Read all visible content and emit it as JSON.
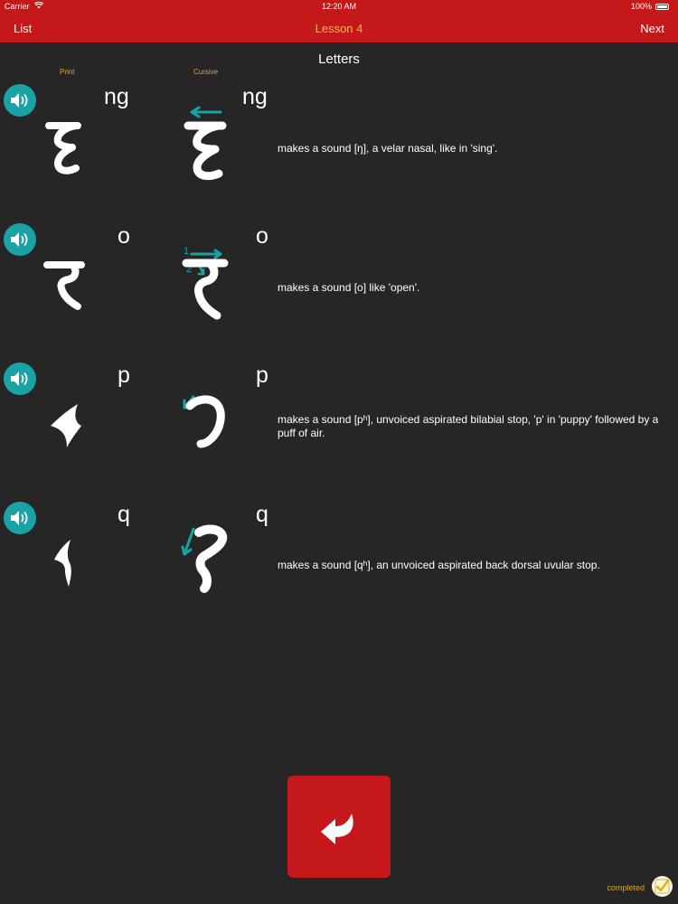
{
  "status_bar": {
    "carrier": "Carrier",
    "time": "12:20 AM",
    "battery": "100%"
  },
  "nav": {
    "left": "List",
    "title": "Lesson 4",
    "right": "Next"
  },
  "section": {
    "title": "Letters",
    "print_label": "Print",
    "cursive_label": "Cursive"
  },
  "letters": [
    {
      "latin": "ng",
      "description": "makes a sound [ŋ], a velar nasal, like in 'sing'."
    },
    {
      "latin": "o",
      "description": "makes a sound [o] like 'open'."
    },
    {
      "latin": "p",
      "description": "makes a sound [pʰ], unvoiced aspirated bilabial stop, 'p' in 'puppy' followed by a puff of air."
    },
    {
      "latin": "q",
      "description": "makes a sound [qʰ], an unvoiced aspirated back dorsal uvular stop."
    }
  ],
  "stroke_numbers": {
    "first": "1",
    "second": "2"
  },
  "footer": {
    "completed_label": "completed"
  },
  "colors": {
    "accent_red": "#c4181b",
    "teal": "#1aa3a6",
    "gold": "#d8a83a",
    "title_orange": "#f4b942",
    "background": "#262626"
  },
  "icons": {
    "speaker": "speaker-volume-icon",
    "return": "return-arrow-icon",
    "check": "checkmark-icon"
  }
}
